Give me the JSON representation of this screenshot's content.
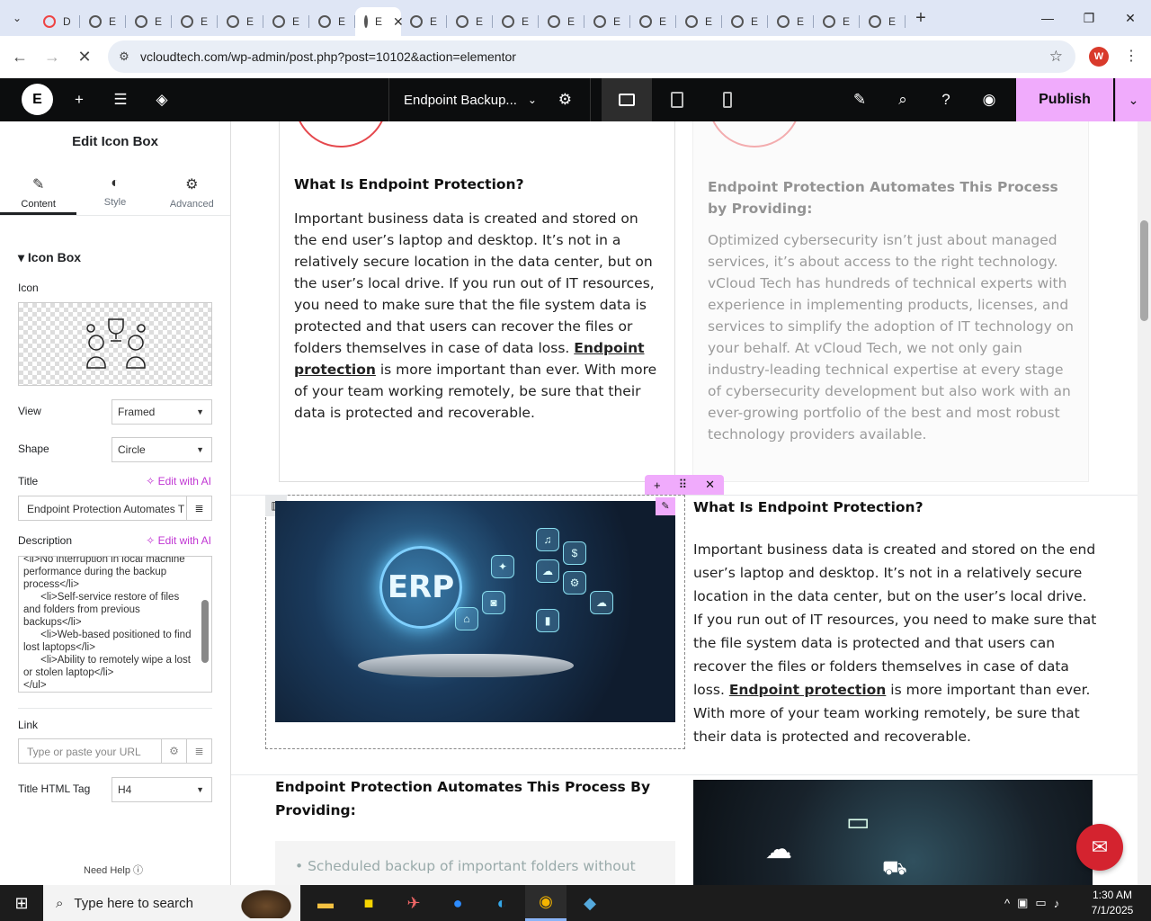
{
  "browser": {
    "tabs": [
      "D",
      "E",
      "E",
      "E",
      "E",
      "E",
      "E",
      "E",
      "E",
      "E",
      "E",
      "E",
      "E",
      "E",
      "E",
      "E",
      "E",
      "E",
      "E",
      "E"
    ],
    "url": "vcloudtech.com/wp-admin/post.php?post=10102&action=elementor",
    "profile_initial": "W"
  },
  "editor": {
    "doc_title": "Endpoint Backup...",
    "publish_label": "Publish"
  },
  "panel": {
    "title": "Edit Icon Box",
    "tabs": [
      {
        "label": "Content",
        "icon": "pencil-icon"
      },
      {
        "label": "Style",
        "icon": "half-circle-icon"
      },
      {
        "label": "Advanced",
        "icon": "gear-icon"
      }
    ],
    "section": "Icon Box",
    "icon_label": "Icon",
    "view_label": "View",
    "view_value": "Framed",
    "shape_label": "Shape",
    "shape_value": "Circle",
    "title_label": "Title",
    "edit_ai": "Edit with AI",
    "title_value": "Endpoint Protection Automates T",
    "description_label": "Description",
    "description_value": "<li>No interruption in local machine performance during the backup process</li>\n      <li>Self-service restore of files and folders from previous backups</li>\n      <li>Web-based positioned to find lost laptops</li>\n      <li>Ability to remotely wipe a lost or stolen laptop</li>\n</ul>",
    "link_label": "Link",
    "link_placeholder": "Type or paste your URL",
    "html_tag_label": "Title HTML Tag",
    "html_tag_value": "H4",
    "need_help": "Need Help"
  },
  "canvas": {
    "card1_title": "What Is Endpoint Protection?",
    "card1_body_pre": "Important business data is created and stored on the end user’s laptop and desktop. It’s not in a relatively secure location in the data center, but on the user’s local drive. If you run out of IT resources, you need to make sure that the file system data is protected and that users can recover the files or folders themselves in case of data loss.",
    "card1_link": "Endpoint protection",
    "card1_body_post": "is more important than ever. With more of your team working remotely, be sure that their data is protected and recoverable.",
    "card2_title": "Endpoint Protection Automates This Process by Providing:",
    "card2_body": "Optimized cybersecurity isn’t just about managed services, it’s about access to the right technology. vCloud Tech has hundreds of technical experts with experience in implementing products, licenses, and services to simplify the adoption of IT technology on your behalf. At vCloud Tech, we not only gain industry-leading technical expertise at every stage of cybersecurity development but also work with an ever-growing portfolio of the best and most robust technology providers available.",
    "erp_label": "ERP",
    "row2_title": "What Is Endpoint Protection?",
    "row2_body_pre": "Important business data is created and stored on the end user’s laptop and desktop. It’s not in a relatively secure location in the data center, but on the user’s local drive. If you run out of IT resources, you need to make sure that the file system data is protected and that users can recover the files or folders themselves in case of data loss.",
    "row2_link": "Endpoint protection",
    "row2_body_post": "is more important than ever. With more of your team working remotely, be sure that their data is protected and recoverable.",
    "row3_title": "Endpoint Protection Automates This Process By Providing:",
    "row3_bullet": "Scheduled backup of important folders without"
  },
  "taskbar": {
    "search_placeholder": "Type here to search",
    "time": "1:30 AM",
    "date": "7/1/2025"
  },
  "colors": {
    "accent": "#f0abfc",
    "brand_red": "#d4232f",
    "topbar": "#0c0d0e"
  }
}
